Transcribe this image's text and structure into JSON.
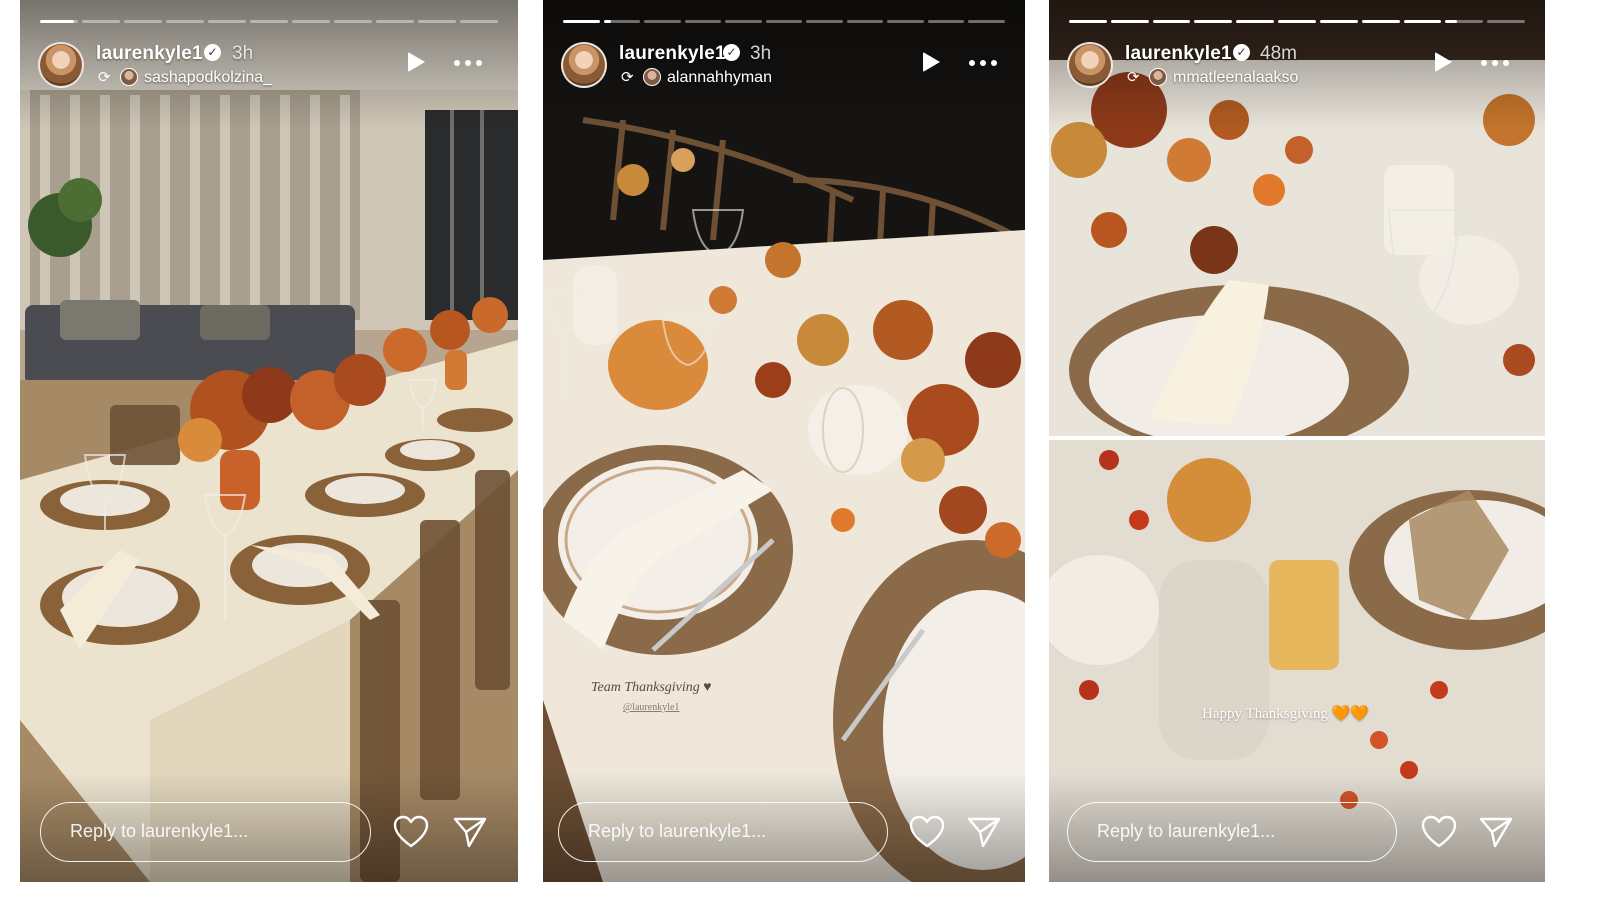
{
  "stories": [
    {
      "username": "laurenkyle1",
      "time": "3h",
      "reposter": "sashapodkolzina_",
      "reply_placeholder": "Reply to laurenkyle1...",
      "segments": 11,
      "progress_active_index": 0,
      "progress_active_fraction": 0.9
    },
    {
      "username": "laurenkyle1",
      "time": "3h",
      "reposter": "alannahhyman",
      "reply_placeholder": "Reply to laurenkyle1...",
      "caption": "Team Thanksgiving ♥",
      "caption_handle": "@laurenkyle1",
      "segments": 11,
      "progress_active_index": 1,
      "progress_active_fraction": 0.2
    },
    {
      "username": "laurenkyle1",
      "time": "48m",
      "reposter": "mmatleenalaakso",
      "reply_placeholder": "Reply to laurenkyle1...",
      "caption": "Happy Thanksgiving 🧡🧡",
      "segments": 11,
      "progress_active_index": 9,
      "progress_active_fraction": 0.3
    }
  ],
  "icons": {
    "verified": "verified-badge-icon",
    "repost": "repost-icon",
    "play": "play-icon",
    "more": "more-options-icon",
    "like": "heart-icon",
    "share": "send-icon"
  },
  "colors": {
    "text": "#ffffff",
    "autumn_orange": "#d9822b",
    "linen": "#f3ead8"
  }
}
